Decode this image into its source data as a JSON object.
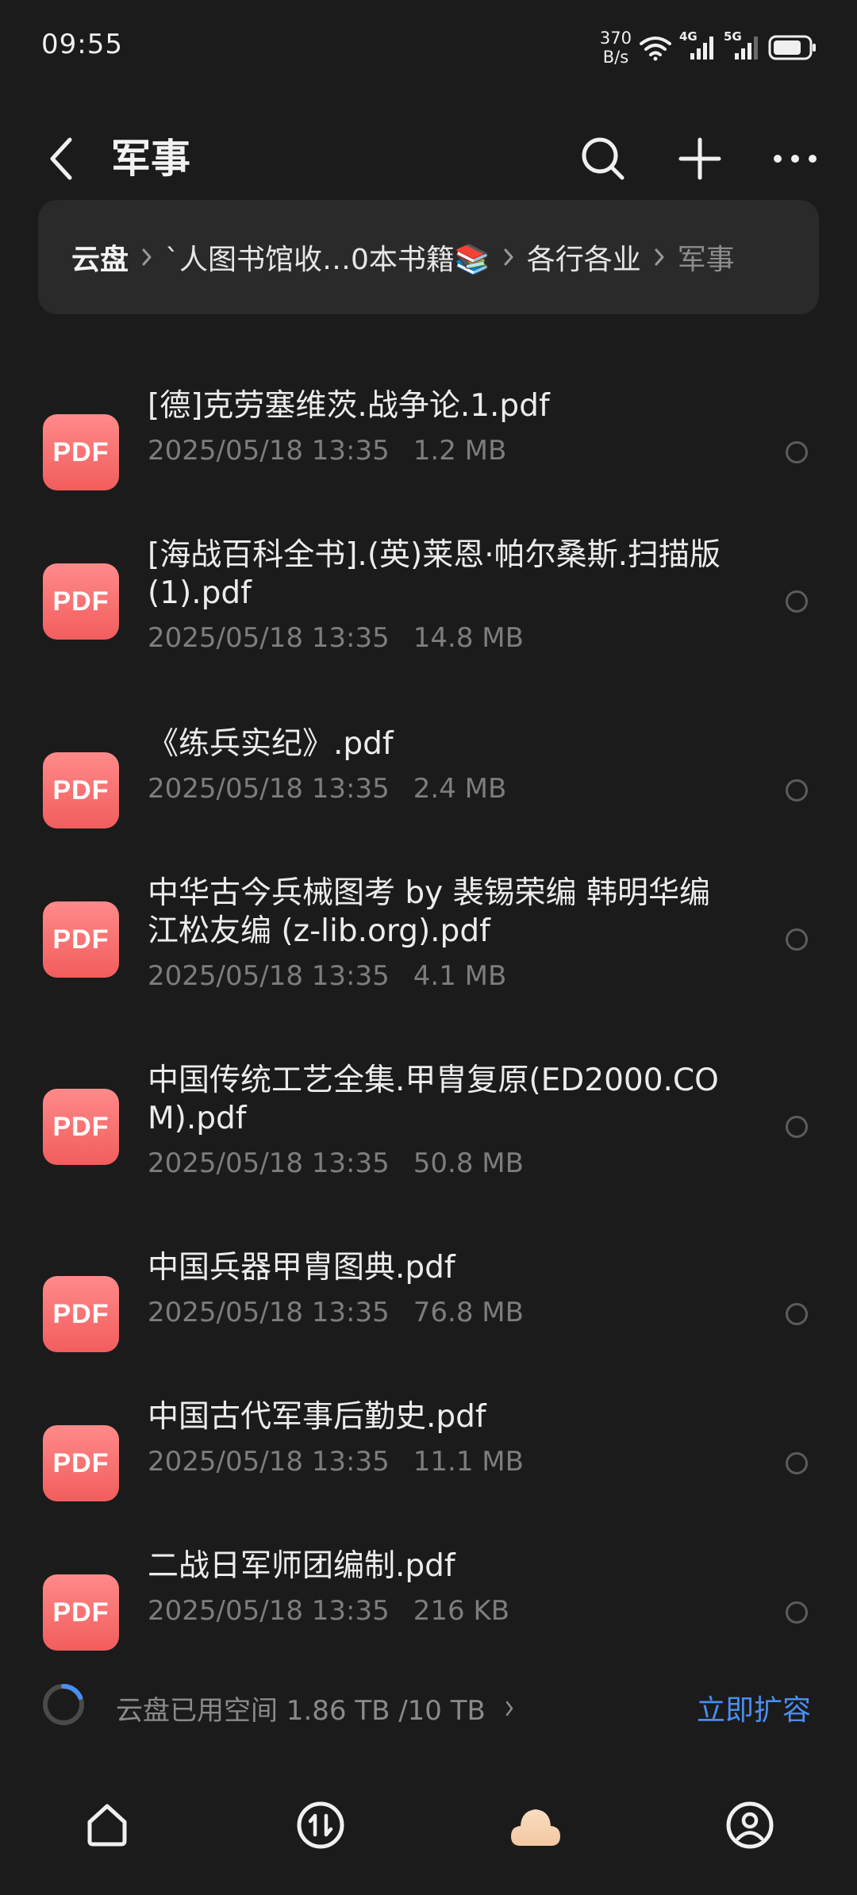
{
  "status_bar": {
    "time": "09:55",
    "net_speed_value": "370",
    "net_speed_unit": "B/s",
    "signal_1_label": "4G",
    "signal_2_label": "5G"
  },
  "header": {
    "title": "军事"
  },
  "breadcrumb": {
    "items": [
      "云盘",
      "`人图书馆收…0本书籍📚",
      "各行各业",
      "军事"
    ]
  },
  "files": [
    {
      "icon_label": "PDF",
      "name": "[德]克劳塞维茨.战争论.1.pdf",
      "date": "2025/05/18 13:35",
      "size": "1.2 MB"
    },
    {
      "icon_label": "PDF",
      "name": "[海战百科全书].(英)莱恩·帕尔桑斯.扫描版(1).pdf",
      "date": "2025/05/18 13:35",
      "size": "14.8 MB"
    },
    {
      "icon_label": "PDF",
      "name": "《练兵实纪》.pdf",
      "date": "2025/05/18 13:35",
      "size": "2.4 MB"
    },
    {
      "icon_label": "PDF",
      "name": "中华古今兵械图考 by 裴锡荣编  韩明华编  江松友编 (z-lib.org).pdf",
      "date": "2025/05/18 13:35",
      "size": "4.1 MB"
    },
    {
      "icon_label": "PDF",
      "name": "中国传统工艺全集.甲胄复原(ED2000.COM).pdf",
      "date": "2025/05/18 13:35",
      "size": "50.8 MB"
    },
    {
      "icon_label": "PDF",
      "name": "中国兵器甲胄图典.pdf",
      "date": "2025/05/18 13:35",
      "size": "76.8 MB"
    },
    {
      "icon_label": "PDF",
      "name": "中国古代军事后勤史.pdf",
      "date": "2025/05/18 13:35",
      "size": "11.1 MB"
    },
    {
      "icon_label": "PDF",
      "name": "二战日军师团编制.pdf",
      "date": "2025/05/18 13:35",
      "size": "216 KB"
    }
  ],
  "storage": {
    "text": "云盘已用空间 1.86 TB /10 TB",
    "used_fraction": 0.186,
    "expand_label": "立即扩容"
  },
  "colors": {
    "background": "#1b1b1b",
    "pdf_icon": "#f25d5d",
    "accent_link": "#4a8ef0",
    "cloud_active": "#f6d8b8"
  }
}
